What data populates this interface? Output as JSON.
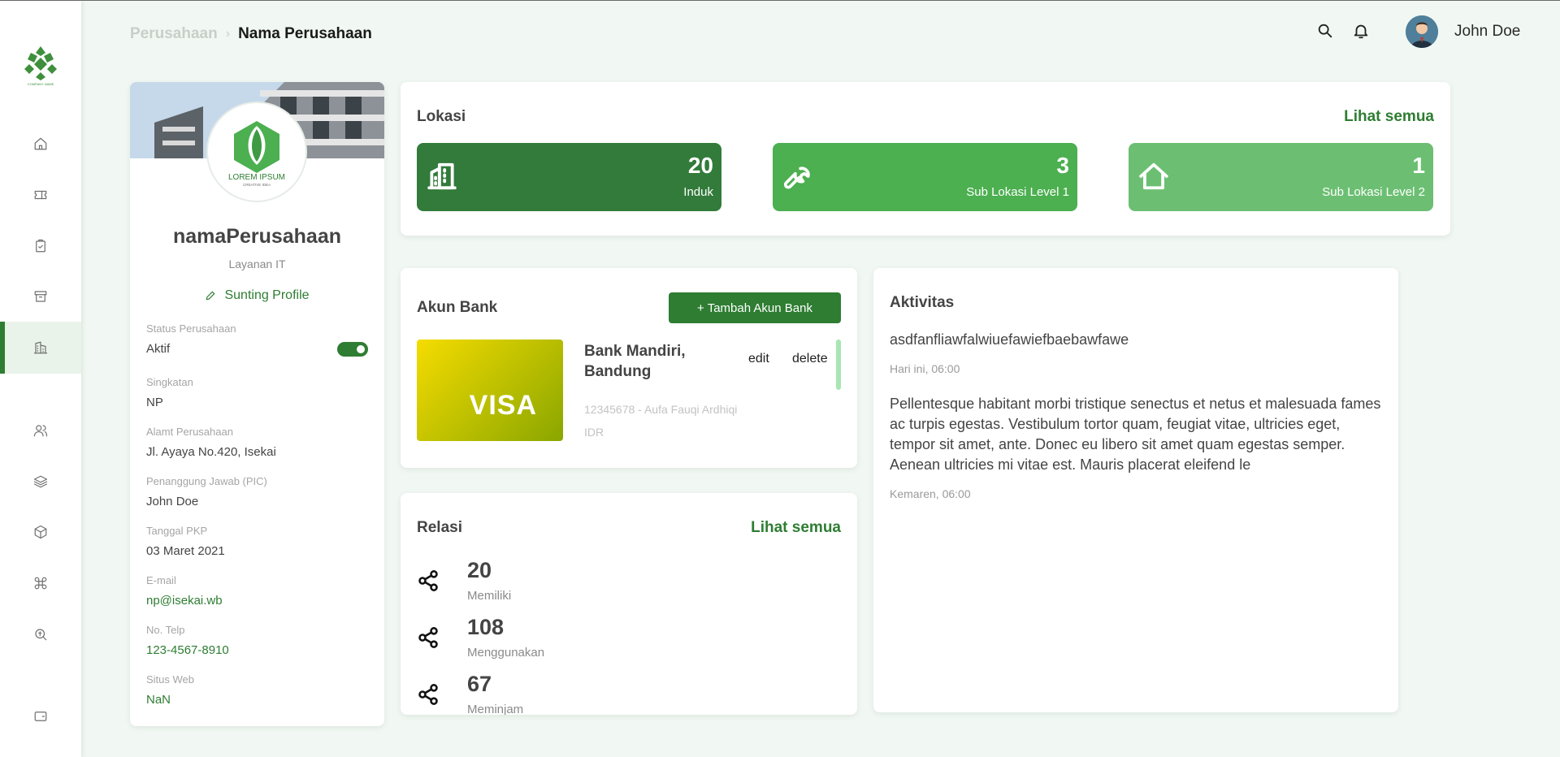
{
  "breadcrumb": {
    "parent": "Perusahaan",
    "separator": "›",
    "current": "Nama Perusahaan"
  },
  "user": {
    "name": "John Doe"
  },
  "logo": {
    "caption": "COMPANY NAME"
  },
  "profile": {
    "company_name": "namaPerusahaan",
    "company_type": "Layanan IT",
    "edit_label": "Sunting Profile",
    "logo_text": "LOREM IPSUM",
    "logo_subtext": "CREATIVE IDEA",
    "fields": [
      {
        "label": "Status Perusahaan",
        "value": "Aktif"
      },
      {
        "label": "Singkatan",
        "value": "NP"
      },
      {
        "label": "Alamt Perusahaan",
        "value": "Jl. Ayaya No.420, Isekai"
      },
      {
        "label": "Penanggung Jawab (PIC)",
        "value": "John Doe"
      },
      {
        "label": "Tanggal PKP",
        "value": "03 Maret 2021"
      },
      {
        "label": "E-mail",
        "value": "np@isekai.wb"
      },
      {
        "label": "No. Telp",
        "value": "123-4567-8910"
      },
      {
        "label": "Situs Web",
        "value": "NaN"
      }
    ]
  },
  "lokasi": {
    "title": "Lokasi",
    "see_all": "Lihat semua",
    "tiles": [
      {
        "value": "20",
        "label": "Induk",
        "color": "#327b3a"
      },
      {
        "value": "3",
        "label": "Sub Lokasi Level 1",
        "color": "#4caf50"
      },
      {
        "value": "1",
        "label": "Sub Lokasi Level 2",
        "color": "#6cbf72"
      }
    ]
  },
  "bank": {
    "title": "Akun Bank",
    "add_label": "+ Tambah Akun Bank",
    "card_brand": "VISA",
    "name": "Bank Mandiri, Bandung",
    "edit_label": "edit",
    "delete_label": "delete",
    "account": "12345678 - Aufa Fauqi Ardhiqi",
    "currency": "IDR"
  },
  "relasi": {
    "title": "Relasi",
    "see_all": "Lihat semua",
    "items": [
      {
        "value": "20",
        "label": "Memiliki"
      },
      {
        "value": "108",
        "label": "Menggunakan"
      },
      {
        "value": "67",
        "label": "Meminjam"
      }
    ]
  },
  "aktivitas": {
    "title": "Aktivitas",
    "items": [
      {
        "text": "asdfanfliawfalwiuefawiefbaebawfawe",
        "time": "Hari ini, 06:00"
      },
      {
        "text": "Pellentesque habitant morbi tristique senectus et netus et malesuada fames ac turpis egestas. Vestibulum tortor quam, feugiat vitae, ultricies eget, tempor sit amet, ante. Donec eu libero sit amet quam egestas semper. Aenean ultricies mi vitae est. Mauris placerat eleifend le",
        "time": "Kemaren, 06:00"
      }
    ]
  },
  "colors": {
    "primary": "#2e7d32",
    "background": "#f1f8f3"
  }
}
